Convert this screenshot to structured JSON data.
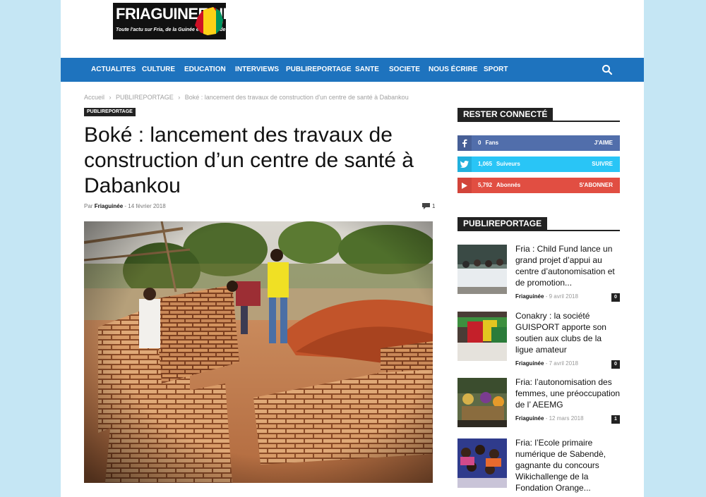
{
  "logo": {
    "name": "FRIAGUINEE.NET",
    "tagline": "Toute l'actu sur Fria, de la Guinée et du monde"
  },
  "nav": {
    "items": [
      "ACTUALITES",
      "CULTURE",
      "EDUCATION",
      "INTERVIEWS",
      "PUBLIREPORTAGE",
      "SANTE",
      "SOCIETE",
      "NOUS ÉCRIRE",
      "SPORT"
    ]
  },
  "breadcrumb": [
    "Accueil",
    "›",
    "PUBLIREPORTAGE",
    "›",
    "Boké : lancement des travaux de construction d'un centre de santé à Dabankou"
  ],
  "article": {
    "category": "PUBLIREPORTAGE",
    "title": "Boké : lancement des travaux de construction d’un centre de santé à Dabankou",
    "by": "Par",
    "author": "Friaguinée",
    "sep": "-",
    "date": "14 février 2018",
    "comments": "1"
  },
  "sidebar": {
    "connect_title": "RESTER CONNECTÉ",
    "social": [
      {
        "network": "facebook",
        "count": "0",
        "label": "Fans",
        "action": "J'AIME",
        "color": "#516eab"
      },
      {
        "network": "twitter",
        "count": "1,065",
        "label": "Suiveurs",
        "action": "SUIVRE",
        "color": "#29c5f6"
      },
      {
        "network": "youtube",
        "count": "5,792",
        "label": "Abonnés",
        "action": "S'ABONNER",
        "color": "#e14e42"
      }
    ],
    "section_title": "PUBLIREPORTAGE",
    "posts": [
      {
        "title": "Fria : Child Fund lance un grand projet d’appui au centre d’autonomisation et de promotion...",
        "author": "Friaguinée",
        "sep": "-",
        "date": "9 avril 2018",
        "comments": "0"
      },
      {
        "title": "Conakry : la société GUISPORT apporte son soutien aux clubs de la ligue amateur",
        "author": "Friaguinée",
        "sep": "-",
        "date": "7 avril 2018",
        "comments": "0"
      },
      {
        "title": "Fria: l’autonomisation des femmes, une préoccupation de l’ AEEMG",
        "author": "Friaguinée",
        "sep": "-",
        "date": "12 mars 2018",
        "comments": "1"
      },
      {
        "title": "Fria: l’Ecole primaire numérique de Sabendè, gagnante du concours Wikichallenge de la Fondation Orange...",
        "author": "",
        "sep": "",
        "date": "",
        "comments": ""
      }
    ]
  },
  "colors": {
    "nav": "#1e73be",
    "page_bg": "#c5e6f4",
    "dark": "#222222"
  }
}
